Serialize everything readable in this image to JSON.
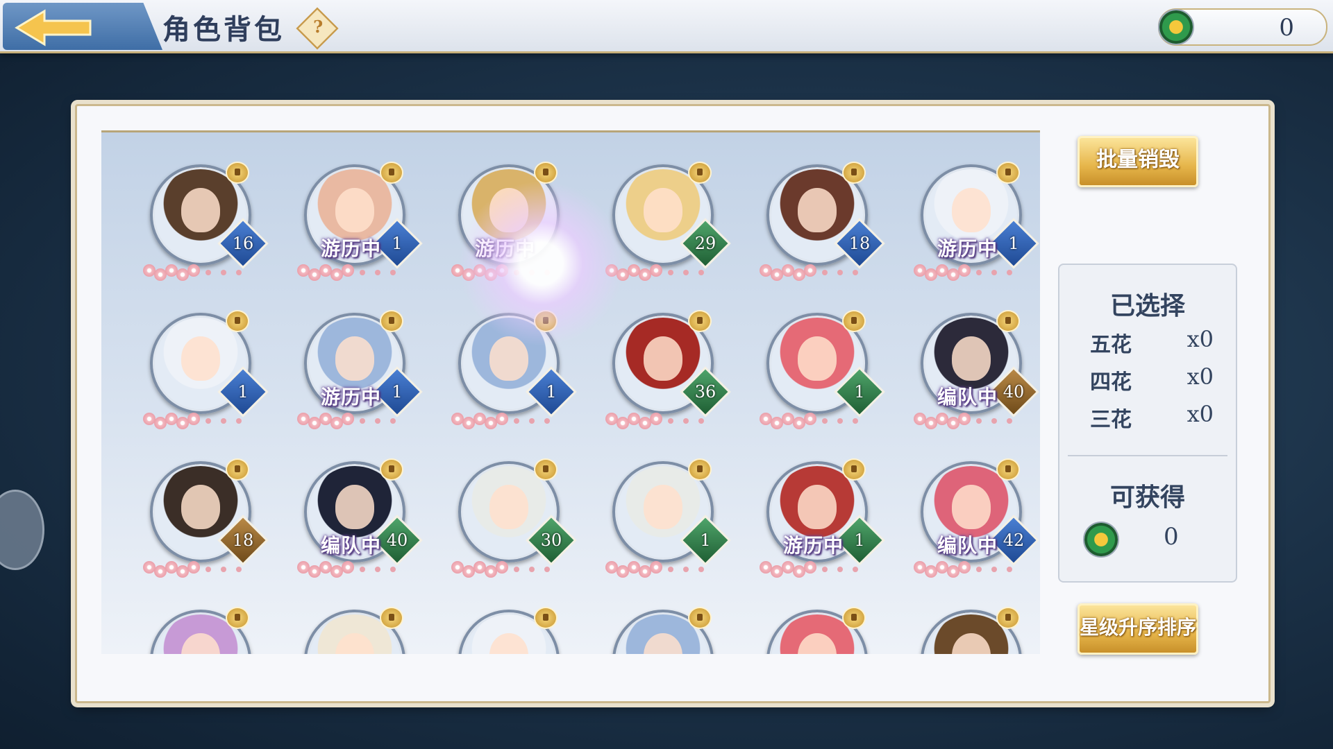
{
  "header": {
    "title": "角色背包",
    "help_symbol": "?",
    "currency_value": "0",
    "accent_color": "#c8b07a"
  },
  "characters": [
    {
      "level": "16",
      "status": "",
      "badge": "blue",
      "hair": "#5a3f2c"
    },
    {
      "level": "1",
      "status": "游历中",
      "badge": "blue",
      "hair": "#e9b9a2"
    },
    {
      "level": "",
      "status": "游历中",
      "badge": "blue",
      "hair": "#d9b36a"
    },
    {
      "level": "29",
      "status": "",
      "badge": "green",
      "hair": "#edcf8a"
    },
    {
      "level": "18",
      "status": "",
      "badge": "blue",
      "hair": "#6b3a2c"
    },
    {
      "level": "1",
      "status": "游历中",
      "badge": "blue",
      "hair": "#eef2f8"
    },
    {
      "level": "1",
      "status": "",
      "badge": "blue",
      "hair": "#eef2f8"
    },
    {
      "level": "1",
      "status": "游历中",
      "badge": "blue",
      "hair": "#9db7dc"
    },
    {
      "level": "1",
      "status": "",
      "badge": "blue",
      "hair": "#9db7dc"
    },
    {
      "level": "36",
      "status": "",
      "badge": "green",
      "hair": "#a62a25"
    },
    {
      "level": "1",
      "status": "",
      "badge": "green",
      "hair": "#e56a76"
    },
    {
      "level": "40",
      "status": "编队中",
      "badge": "brown",
      "hair": "#2c2a3a"
    },
    {
      "level": "18",
      "status": "",
      "badge": "brown",
      "hair": "#3b2e27"
    },
    {
      "level": "40",
      "status": "编队中",
      "badge": "green",
      "hair": "#1f2438"
    },
    {
      "level": "30",
      "status": "",
      "badge": "green",
      "hair": "#e8ebe8"
    },
    {
      "level": "1",
      "status": "",
      "badge": "green",
      "hair": "#e8ebe8"
    },
    {
      "level": "1",
      "status": "游历中",
      "badge": "green",
      "hair": "#b73a36"
    },
    {
      "level": "42",
      "status": "编队中",
      "badge": "blue",
      "hair": "#de6479"
    },
    {
      "level": "",
      "status": "",
      "badge": "blue",
      "hair": "#c79ad6"
    },
    {
      "level": "",
      "status": "",
      "badge": "blue",
      "hair": "#efe7d6"
    },
    {
      "level": "",
      "status": "",
      "badge": "blue",
      "hair": "#eef2f8"
    },
    {
      "level": "",
      "status": "",
      "badge": "blue",
      "hair": "#9db7dc"
    },
    {
      "level": "",
      "status": "",
      "badge": "blue",
      "hair": "#e56a76"
    },
    {
      "level": "",
      "status": "",
      "badge": "blue",
      "hair": "#6b4a2a"
    }
  ],
  "actions": {
    "batch_destroy": "批量销毁",
    "sort_by_star": "星级升序排序"
  },
  "summary": {
    "selected_title": "已选择",
    "rows": [
      {
        "label": "五花",
        "count": "x0"
      },
      {
        "label": "四花",
        "count": "x0"
      },
      {
        "label": "三花",
        "count": "x0"
      }
    ],
    "obtainable_title": "可获得",
    "obtainable_value": "0"
  }
}
